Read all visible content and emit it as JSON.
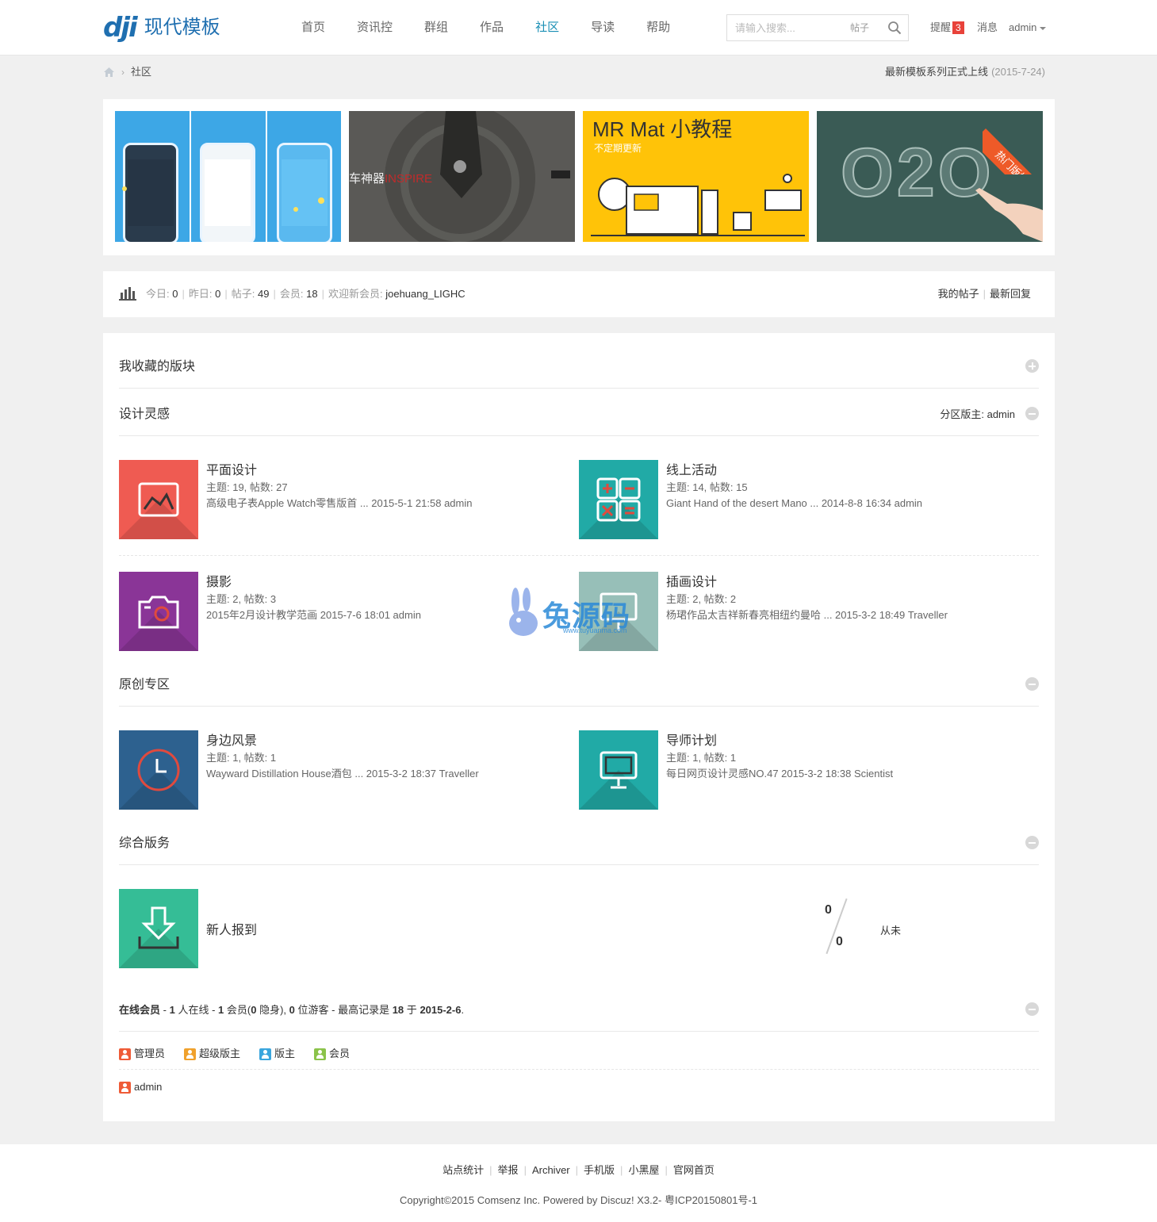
{
  "header": {
    "logo_mark": "dji",
    "logo_text": "现代模板",
    "nav": [
      "首页",
      "资讯控",
      "群组",
      "作品",
      "社区",
      "导读",
      "帮助"
    ],
    "active_nav": "社区",
    "search": {
      "placeholder": "请输入搜索...",
      "type": "帖子"
    },
    "notice_label": "提醒",
    "notice_count": "3",
    "message_label": "消息",
    "user": "admin"
  },
  "breadcrumb": {
    "current": "社区"
  },
  "announcement": {
    "text": "最新模板系列正式上线",
    "date": "(2015-7-24)"
  },
  "banner": {
    "slide2_text": "车神器",
    "slide2_accent": "INSPIRE",
    "slide3_title": "MR Mat 小教程",
    "slide3_sub": "不定期更新",
    "slide4_text": "O2O",
    "ribbon": "热门版块"
  },
  "stats": {
    "today_label": "今日:",
    "today": "0",
    "yesterday_label": "昨日:",
    "yesterday": "0",
    "posts_label": "帖子:",
    "posts": "49",
    "members_label": "会员:",
    "members": "18",
    "welcome_label": "欢迎新会员:",
    "new_member": "joehuang_LIGHC",
    "my_posts": "我的帖子",
    "latest_replies": "最新回复"
  },
  "sections": {
    "favorites": {
      "title": "我收藏的版块"
    },
    "design": {
      "title": "设计灵感",
      "moderator": "分区版主: admin"
    },
    "original": {
      "title": "原创专区"
    },
    "service": {
      "title": "综合版务"
    }
  },
  "forums": {
    "graphic": {
      "name": "平面设计",
      "counts": "主题: 19, 帖数: 27",
      "last": "高级电子表Apple Watch零售版首 ... 2015-5-1 21:58 admin",
      "color": "#ef5b52"
    },
    "online_activity": {
      "name": "线上活动",
      "counts": "主题: 14, 帖数: 15",
      "last": "Giant Hand of the desert Mano ... 2014-8-8 16:34 admin",
      "color": "#21aaa6"
    },
    "photo": {
      "name": "摄影",
      "counts": "主题: 2, 帖数: 3",
      "last": "2015年2月设计教学范画 2015-7-6 18:01 admin",
      "color": "#8a3597"
    },
    "illustration": {
      "name": "插画设计",
      "counts": "主题: 2, 帖数: 2",
      "last": "杨珺作品太吉祥新春亮相纽约曼哈 ... 2015-3-2 18:49 Traveller",
      "color": "#97bfb8"
    },
    "scenery": {
      "name": "身边风景",
      "counts": "主题: 1, 帖数: 1",
      "last": "Wayward Distillation House酒包 ... 2015-3-2 18:37 Traveller",
      "color": "#2d618f"
    },
    "mentor": {
      "name": "导师计划",
      "counts": "主题: 1, 帖数: 1",
      "last": "每日网页设计灵感NO.47 2015-3-2 18:38 Scientist",
      "color": "#21aaa6"
    },
    "newbie": {
      "name": "新人报到",
      "threads": "0",
      "posts": "0",
      "last": "从未",
      "color": "#35bd96"
    }
  },
  "online": {
    "label": "在线会员",
    "online_count": "1",
    "online_text": "人在线",
    "members_count": "1",
    "members_text": "会员(",
    "hidden_count": "0",
    "hidden_text": "隐身),",
    "guests_count": "0",
    "guests_text": "位游客 - 最高记录是",
    "record": "18",
    "record_text": "于",
    "record_date": "2015-2-6",
    "legend": [
      "管理员",
      "超级版主",
      "版主",
      "会员"
    ],
    "legend_colors": [
      "#ef5b37",
      "#f0a12c",
      "#3aa6dd",
      "#8bc34a"
    ],
    "users": [
      "admin"
    ]
  },
  "footer": {
    "links": [
      "站点统计",
      "举报",
      "Archiver",
      "手机版",
      "小黑屋",
      "官网首页"
    ],
    "copyright": "Copyright©2015 Comsenz Inc. Powered by Discuz! X3.2- 粤ICP20150801号-1"
  },
  "watermark": {
    "text": "兔源码",
    "sub": "www.tuyuanma.com"
  }
}
